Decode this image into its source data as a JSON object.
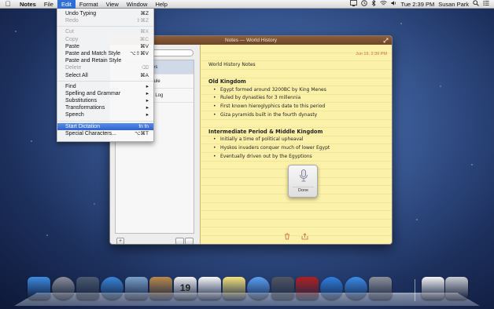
{
  "menubar": {
    "app_name": "Notes",
    "items": [
      "File",
      "Edit",
      "Format",
      "View",
      "Window",
      "Help"
    ],
    "clock": "Tue 2:39 PM",
    "user": "Susan Park"
  },
  "edit_menu": {
    "items": [
      {
        "label": "Undo Typing",
        "shortcut": "⌘Z"
      },
      {
        "label": "Redo",
        "shortcut": "⇧⌘Z",
        "disabled": true
      },
      {
        "label": "Cut",
        "shortcut": "⌘X",
        "disabled": true
      },
      {
        "label": "Copy",
        "shortcut": "⌘C",
        "disabled": true
      },
      {
        "label": "Paste",
        "shortcut": "⌘V"
      },
      {
        "label": "Paste and Match Style",
        "shortcut": "⌥⇧⌘V"
      },
      {
        "label": "Paste and Retain Style",
        "shortcut": ""
      },
      {
        "label": "Delete",
        "shortcut": "⌫",
        "disabled": true
      },
      {
        "label": "Select All",
        "shortcut": "⌘A"
      },
      {
        "label": "Find",
        "shortcut": "▸"
      },
      {
        "label": "Spelling and Grammar",
        "shortcut": "▸"
      },
      {
        "label": "Substitutions",
        "shortcut": "▸"
      },
      {
        "label": "Transformations",
        "shortcut": "▸"
      },
      {
        "label": "Speech",
        "shortcut": "▸"
      },
      {
        "label": "Start Dictation",
        "shortcut": "fn fn",
        "highlighted": true
      },
      {
        "label": "Special Characters...",
        "shortcut": "⌥⌘T"
      }
    ]
  },
  "notes_window": {
    "title": "Notes — World History",
    "sidebar_rows": [
      "otes",
      "edule",
      "ng Log"
    ],
    "note_date": "Jun 19, 2:39 PM",
    "note_lines": [
      {
        "text": "World History Notes",
        "style": "plain"
      },
      {
        "text": "",
        "style": "plain"
      },
      {
        "text": "Old Kingdom",
        "style": "head"
      },
      {
        "text": "Egypt formed around 3200BC by King Menes",
        "style": "bullet"
      },
      {
        "text": "Ruled by dynasties for 3 millennia",
        "style": "bullet"
      },
      {
        "text": "First known hieroglyphics date to this period",
        "style": "bullet"
      },
      {
        "text": "Giza pyramids built in the fourth dynasty",
        "style": "bullet"
      },
      {
        "text": "",
        "style": "plain"
      },
      {
        "text": "Intermediate Period & Middle Kingdom",
        "style": "head"
      },
      {
        "text": "Initially a time of political upheaval",
        "style": "bullet"
      },
      {
        "text": "Hyskos invaders conquer much of lower Egypt",
        "style": "bullet"
      },
      {
        "text": "Eventually driven out by the Egyptions",
        "style": "bullet"
      }
    ]
  },
  "dictation": {
    "done_label": "Done"
  },
  "dock": {
    "items": [
      {
        "name": "finder-icon",
        "color": "#3d8be0"
      },
      {
        "name": "launchpad-icon",
        "color": "#8a8f99"
      },
      {
        "name": "mission-control-icon",
        "color": "#4b5a70"
      },
      {
        "name": "safari-icon",
        "color": "#3a86d8"
      },
      {
        "name": "mail-icon",
        "color": "#7aa0c8"
      },
      {
        "name": "contacts-icon",
        "color": "#b98a4a"
      },
      {
        "name": "calendar-icon",
        "color": "#f2f2f2",
        "text": "19"
      },
      {
        "name": "reminders-icon",
        "color": "#f7f7f7"
      },
      {
        "name": "notes-icon",
        "color": "#f6e27a"
      },
      {
        "name": "messages-icon",
        "color": "#5aa0f0"
      },
      {
        "name": "facetime-icon",
        "color": "#505560"
      },
      {
        "name": "photo-booth-icon",
        "color": "#b02020"
      },
      {
        "name": "itunes-icon",
        "color": "#2f7fe0"
      },
      {
        "name": "app-store-icon",
        "color": "#3b8ce8"
      },
      {
        "name": "system-preferences-icon",
        "color": "#8c8f96"
      },
      {
        "name": "document-icon",
        "color": "#f4f4f4"
      },
      {
        "name": "trash-icon",
        "color": "#c9ccd2"
      }
    ]
  }
}
